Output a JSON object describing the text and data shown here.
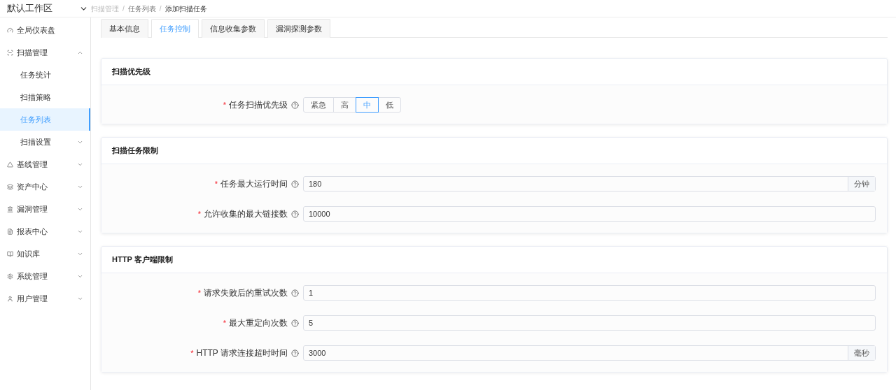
{
  "header": {
    "workspace": "默认工作区",
    "separator": "/",
    "breadcrumb": [
      "扫描管理",
      "任务列表",
      "添加扫描任务"
    ]
  },
  "sidebar": {
    "items": [
      {
        "label": "全局仪表盘"
      },
      {
        "label": "扫描管理",
        "expanded": true,
        "children": [
          {
            "label": "任务统计",
            "selected": false
          },
          {
            "label": "扫描策略",
            "selected": false
          },
          {
            "label": "任务列表",
            "selected": true
          },
          {
            "label": "扫描设置",
            "selected": false,
            "expanded": false
          }
        ]
      },
      {
        "label": "基线管理",
        "expanded": false
      },
      {
        "label": "资产中心",
        "expanded": false
      },
      {
        "label": "漏洞管理",
        "expanded": false
      },
      {
        "label": "报表中心",
        "expanded": false
      },
      {
        "label": "知识库",
        "expanded": false
      },
      {
        "label": "系统管理",
        "expanded": false
      },
      {
        "label": "用户管理",
        "expanded": false
      }
    ]
  },
  "tabs": [
    {
      "label": "基本信息",
      "selected": false
    },
    {
      "label": "任务控制",
      "selected": true
    },
    {
      "label": "信息收集参数",
      "selected": false
    },
    {
      "label": "漏洞探测参数",
      "selected": false
    }
  ],
  "sections": [
    {
      "title": "扫描优先级",
      "fields": [
        {
          "kind": "segmented",
          "mark": "*",
          "label": "任务扫描优先级",
          "options": [
            {
              "label": "紧急",
              "selected": false
            },
            {
              "label": "高",
              "selected": false
            },
            {
              "label": "中",
              "selected": true
            },
            {
              "label": "低",
              "selected": false
            }
          ]
        }
      ]
    },
    {
      "title": "扫描任务限制",
      "fields": [
        {
          "kind": "input",
          "mark": "*",
          "label": "任务最大运行时间",
          "value": "180",
          "suffix": "分钟"
        },
        {
          "kind": "input",
          "mark": "*",
          "label": "允许收集的最大链接数",
          "value": "10000"
        }
      ]
    },
    {
      "title": "HTTP 客户端限制",
      "fields": [
        {
          "kind": "input",
          "mark": "*",
          "label": "请求失败后的重试次数",
          "value": "1"
        },
        {
          "kind": "input",
          "mark": "*",
          "label": "最大重定向次数",
          "value": "5"
        },
        {
          "kind": "input",
          "mark": "*",
          "label": "HTTP 请求连接超时时间",
          "value": "3000",
          "suffix": "毫秒"
        }
      ]
    }
  ]
}
